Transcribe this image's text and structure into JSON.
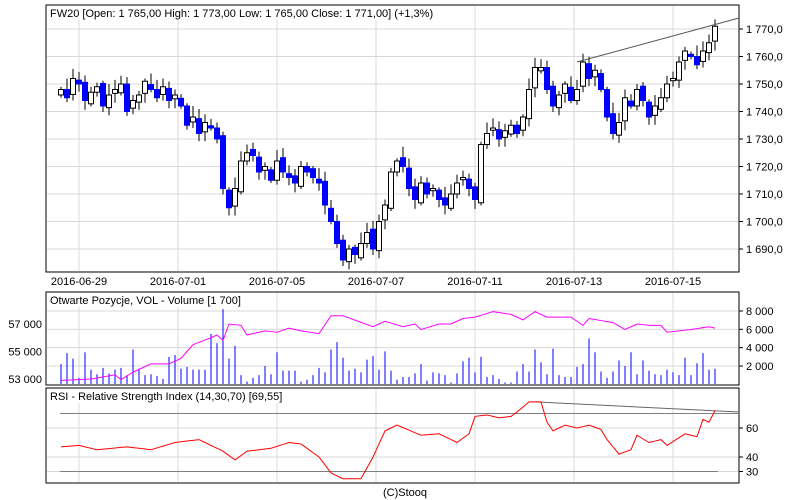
{
  "footer": "(C)Stooq",
  "chart_data": [
    {
      "type": "candlestick",
      "title": "FW20 [Open: 1 765,00  High: 1 773,00  Low: 1 765,00  Close: 1 771,00] (+1,3%)",
      "x_tick_labels": [
        "2016-06-29",
        "2016-07-01",
        "2016-07-05",
        "2016-07-07",
        "2016-07-11",
        "2016-07-13",
        "2016-07-15"
      ],
      "x_tick_index": [
        3,
        19.5,
        36,
        52.5,
        69,
        85.5,
        102
      ],
      "y_tick_labels": [
        "1 770,0",
        "1 760,0",
        "1 750,0",
        "1 740,0",
        "1 730,0",
        "1 720,0",
        "1 710,0",
        "1 700,0",
        "1 690,0"
      ],
      "y_ticks": [
        1770,
        1760,
        1750,
        1740,
        1730,
        1720,
        1710,
        1700,
        1690
      ],
      "ylim": [
        1682,
        1778
      ],
      "closes": [
        1748,
        1745,
        1752,
        1750,
        1744,
        1747,
        1749,
        1742,
        1746,
        1748,
        1750,
        1740,
        1744,
        1746,
        1751,
        1748,
        1745,
        1749,
        1744,
        1746,
        1742,
        1735,
        1738,
        1732,
        1736,
        1734,
        1730,
        1712,
        1705,
        1712,
        1722,
        1725,
        1724,
        1718,
        1720,
        1715,
        1722,
        1718,
        1716,
        1714,
        1720,
        1718,
        1716,
        1714,
        1706,
        1700,
        1692,
        1686,
        1690,
        1688,
        1692,
        1696,
        1690,
        1700,
        1706,
        1718,
        1722,
        1720,
        1712,
        1708,
        1714,
        1710,
        1712,
        1708,
        1706,
        1710,
        1714,
        1716,
        1712,
        1708,
        1728,
        1732,
        1734,
        1730,
        1733,
        1735,
        1732,
        1738,
        1748,
        1756,
        1756,
        1748,
        1742,
        1746,
        1750,
        1744,
        1748,
        1758,
        1752,
        1755,
        1748,
        1738,
        1732,
        1736,
        1745,
        1742,
        1748,
        1744,
        1738,
        1742,
        1745,
        1750,
        1752,
        1758,
        1762,
        1760,
        1757,
        1762,
        1765,
        1771
      ],
      "trendline": [
        [
          86,
          1758
        ],
        [
          115,
          1774
        ]
      ],
      "colors": {
        "down": "#0000ff",
        "up": "#ffffff",
        "grid": "#d8d8d8"
      }
    },
    {
      "type": "bar+line",
      "title": "Otwarte Pozycje, VOL - Volume [1 700]",
      "left_tick_labels": [
        "57 000",
        "55 000",
        "53 000"
      ],
      "left_ticks": [
        57000,
        55000,
        53000
      ],
      "right_tick_labels": [
        "8 000",
        "6 000",
        "4 000",
        "2 000"
      ],
      "right_ticks": [
        8000,
        6000,
        4000,
        2000
      ],
      "volume": [
        2200,
        3400,
        2800,
        700,
        3500,
        1600,
        1100,
        1800,
        1200,
        1600,
        1800,
        1000,
        3800,
        1700,
        1000,
        1100,
        900,
        600,
        3000,
        3200,
        1700,
        1900,
        1600,
        1600,
        1600,
        5500,
        4500,
        8200,
        2800,
        4200,
        1000,
        300,
        700,
        1000,
        2000,
        1100,
        3500,
        1500,
        1500,
        1500,
        300,
        500,
        1000,
        1800,
        1300,
        3800,
        4600,
        2900,
        1500,
        1700,
        1300,
        2700,
        3100,
        1600,
        3600,
        1500,
        500,
        800,
        800,
        1200,
        2200,
        400,
        1300,
        1200,
        1000,
        200,
        1200,
        2500,
        2900,
        1300,
        3000,
        800,
        1000,
        600,
        200,
        200,
        1400,
        2200,
        1400,
        3800,
        2400,
        1100,
        3900,
        1000,
        800,
        800,
        1900,
        2200,
        5000,
        3500,
        1400,
        700,
        1400,
        2600,
        2000,
        3500,
        1100,
        2600,
        1500,
        1100,
        1000,
        1600,
        1300,
        1000,
        2900,
        1000,
        2300,
        3400,
        1600,
        1700
      ],
      "open_interest_points": [
        [
          0,
          52900
        ],
        [
          5,
          53000
        ],
        [
          9,
          53300
        ],
        [
          10,
          52950
        ],
        [
          12,
          53500
        ],
        [
          15,
          54100
        ],
        [
          18,
          54100
        ],
        [
          20,
          54500
        ],
        [
          22,
          55500
        ],
        [
          25,
          56000
        ],
        [
          26,
          56200
        ],
        [
          27,
          55800
        ],
        [
          28,
          57000
        ],
        [
          30,
          56900
        ],
        [
          31,
          56200
        ],
        [
          34,
          56500
        ],
        [
          36,
          56400
        ],
        [
          38,
          56700
        ],
        [
          40,
          56500
        ],
        [
          43,
          56300
        ],
        [
          45,
          57600
        ],
        [
          47,
          57600
        ],
        [
          52,
          56800
        ],
        [
          54,
          57200
        ],
        [
          57,
          56800
        ],
        [
          59,
          57000
        ],
        [
          60,
          56600
        ],
        [
          63,
          57000
        ],
        [
          65,
          57000
        ],
        [
          67,
          57400
        ],
        [
          69,
          57500
        ],
        [
          72,
          57900
        ],
        [
          75,
          57700
        ],
        [
          77,
          57300
        ],
        [
          79,
          57900
        ],
        [
          81,
          57500
        ],
        [
          85,
          57500
        ],
        [
          87,
          56900
        ],
        [
          88,
          57400
        ],
        [
          92,
          57100
        ],
        [
          94,
          56600
        ],
        [
          96,
          57000
        ],
        [
          98,
          56900
        ],
        [
          100,
          56900
        ],
        [
          101,
          56400
        ],
        [
          105,
          56600
        ],
        [
          108,
          56800
        ],
        [
          109,
          56700
        ]
      ],
      "colors": {
        "volume": "#0000ff",
        "open_interest": "#ff00ff"
      }
    },
    {
      "type": "line",
      "title": "RSI - Relative Strength Index (14,30,70) [69,55]",
      "right_tick_labels": [
        "60",
        "40",
        "30"
      ],
      "right_ticks": [
        60,
        40,
        30
      ],
      "levels": [
        70,
        30
      ],
      "rsi_points": [
        [
          0,
          47
        ],
        [
          3,
          48
        ],
        [
          6,
          45
        ],
        [
          11,
          47
        ],
        [
          15,
          45
        ],
        [
          19,
          50
        ],
        [
          23,
          52
        ],
        [
          27,
          44
        ],
        [
          29,
          38
        ],
        [
          31,
          44
        ],
        [
          35,
          46
        ],
        [
          38,
          50
        ],
        [
          40,
          49
        ],
        [
          43,
          40
        ],
        [
          45,
          29
        ],
        [
          47,
          25
        ],
        [
          50,
          25
        ],
        [
          52,
          40
        ],
        [
          54,
          58
        ],
        [
          56,
          62
        ],
        [
          60,
          55
        ],
        [
          63,
          56
        ],
        [
          66,
          50
        ],
        [
          68,
          56
        ],
        [
          69,
          68
        ],
        [
          71,
          69
        ],
        [
          73,
          67
        ],
        [
          75,
          68
        ],
        [
          76,
          71
        ],
        [
          78,
          78
        ],
        [
          80,
          78
        ],
        [
          81,
          64
        ],
        [
          82,
          58
        ],
        [
          84,
          62
        ],
        [
          86,
          60
        ],
        [
          88,
          62
        ],
        [
          90,
          59
        ],
        [
          91,
          52
        ],
        [
          92,
          47
        ],
        [
          93,
          42
        ],
        [
          95,
          45
        ],
        [
          96,
          55
        ],
        [
          98,
          50
        ],
        [
          100,
          52
        ],
        [
          101,
          48
        ],
        [
          104,
          56
        ],
        [
          106,
          54
        ],
        [
          107,
          66
        ],
        [
          108,
          64
        ],
        [
          109,
          72
        ]
      ],
      "trendline": [
        [
          79,
          78
        ],
        [
          113,
          71
        ]
      ],
      "colors": {
        "rsi": "#ff0000",
        "levels": "#808080"
      }
    }
  ]
}
